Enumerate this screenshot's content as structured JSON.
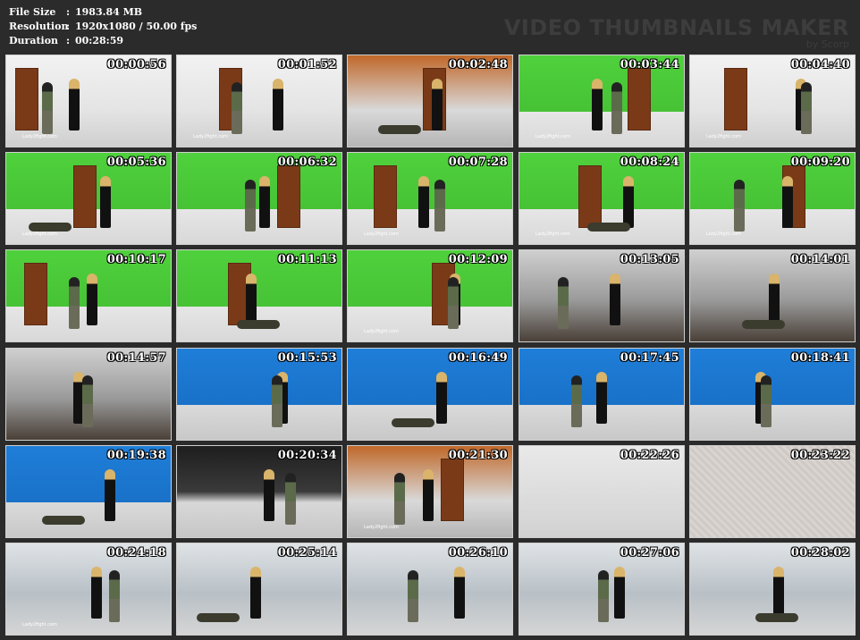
{
  "file_info": {
    "size_label": "File Size",
    "size_value": "1983.84 MB",
    "resolution_label": "Resolution",
    "resolution_value": "1920x1080 / 50.00 fps",
    "duration_label": "Duration",
    "duration_value": "00:28:59",
    "separator": ":"
  },
  "brand": {
    "title": "VIDEO THUMBNAILS MAKER",
    "byline": "by Scorp"
  },
  "thumbnails": [
    {
      "time": "00:00:56",
      "scene": "white",
      "watermark": "Lady2fight.com"
    },
    {
      "time": "00:01:52",
      "scene": "white",
      "watermark": "Lady2fight.com"
    },
    {
      "time": "00:02:48",
      "scene": "orange",
      "watermark": ""
    },
    {
      "time": "00:03:44",
      "scene": "green",
      "watermark": "Lady2fight.com"
    },
    {
      "time": "00:04:40",
      "scene": "white",
      "watermark": "Lady2fight.com"
    },
    {
      "time": "00:05:36",
      "scene": "green",
      "watermark": "Lady2fight.com"
    },
    {
      "time": "00:06:32",
      "scene": "green",
      "watermark": ""
    },
    {
      "time": "00:07:28",
      "scene": "green",
      "watermark": "Lady2fight.com"
    },
    {
      "time": "00:08:24",
      "scene": "green",
      "watermark": "Lady2fight.com"
    },
    {
      "time": "00:09:20",
      "scene": "green",
      "watermark": "Lady2fight.com"
    },
    {
      "time": "00:10:17",
      "scene": "green",
      "watermark": ""
    },
    {
      "time": "00:11:13",
      "scene": "green",
      "watermark": ""
    },
    {
      "time": "00:12:09",
      "scene": "green",
      "watermark": "Lady2fight.com"
    },
    {
      "time": "00:13:05",
      "scene": "stair",
      "watermark": ""
    },
    {
      "time": "00:14:01",
      "scene": "stair",
      "watermark": ""
    },
    {
      "time": "00:14:57",
      "scene": "stair",
      "watermark": ""
    },
    {
      "time": "00:15:53",
      "scene": "blue",
      "watermark": ""
    },
    {
      "time": "00:16:49",
      "scene": "blue",
      "watermark": ""
    },
    {
      "time": "00:17:45",
      "scene": "blue",
      "watermark": ""
    },
    {
      "time": "00:18:41",
      "scene": "blue",
      "watermark": ""
    },
    {
      "time": "00:19:38",
      "scene": "blue",
      "watermark": ""
    },
    {
      "time": "00:20:34",
      "scene": "dark",
      "watermark": ""
    },
    {
      "time": "00:21:30",
      "scene": "orange",
      "watermark": "Lady2fight.com"
    },
    {
      "time": "00:22:26",
      "scene": "grey",
      "watermark": ""
    },
    {
      "time": "00:23:22",
      "scene": "speck",
      "watermark": ""
    },
    {
      "time": "00:24:18",
      "scene": "room",
      "watermark": "Lady2fight.com"
    },
    {
      "time": "00:25:14",
      "scene": "room",
      "watermark": ""
    },
    {
      "time": "00:26:10",
      "scene": "room",
      "watermark": ""
    },
    {
      "time": "00:27:06",
      "scene": "room",
      "watermark": ""
    },
    {
      "time": "00:28:02",
      "scene": "room",
      "watermark": ""
    }
  ],
  "colors": {
    "background": "#2b2b2b",
    "header_text": "#ffffff",
    "brand_text": "#3d3d3d",
    "thumb_border": "#cfcfcf"
  }
}
